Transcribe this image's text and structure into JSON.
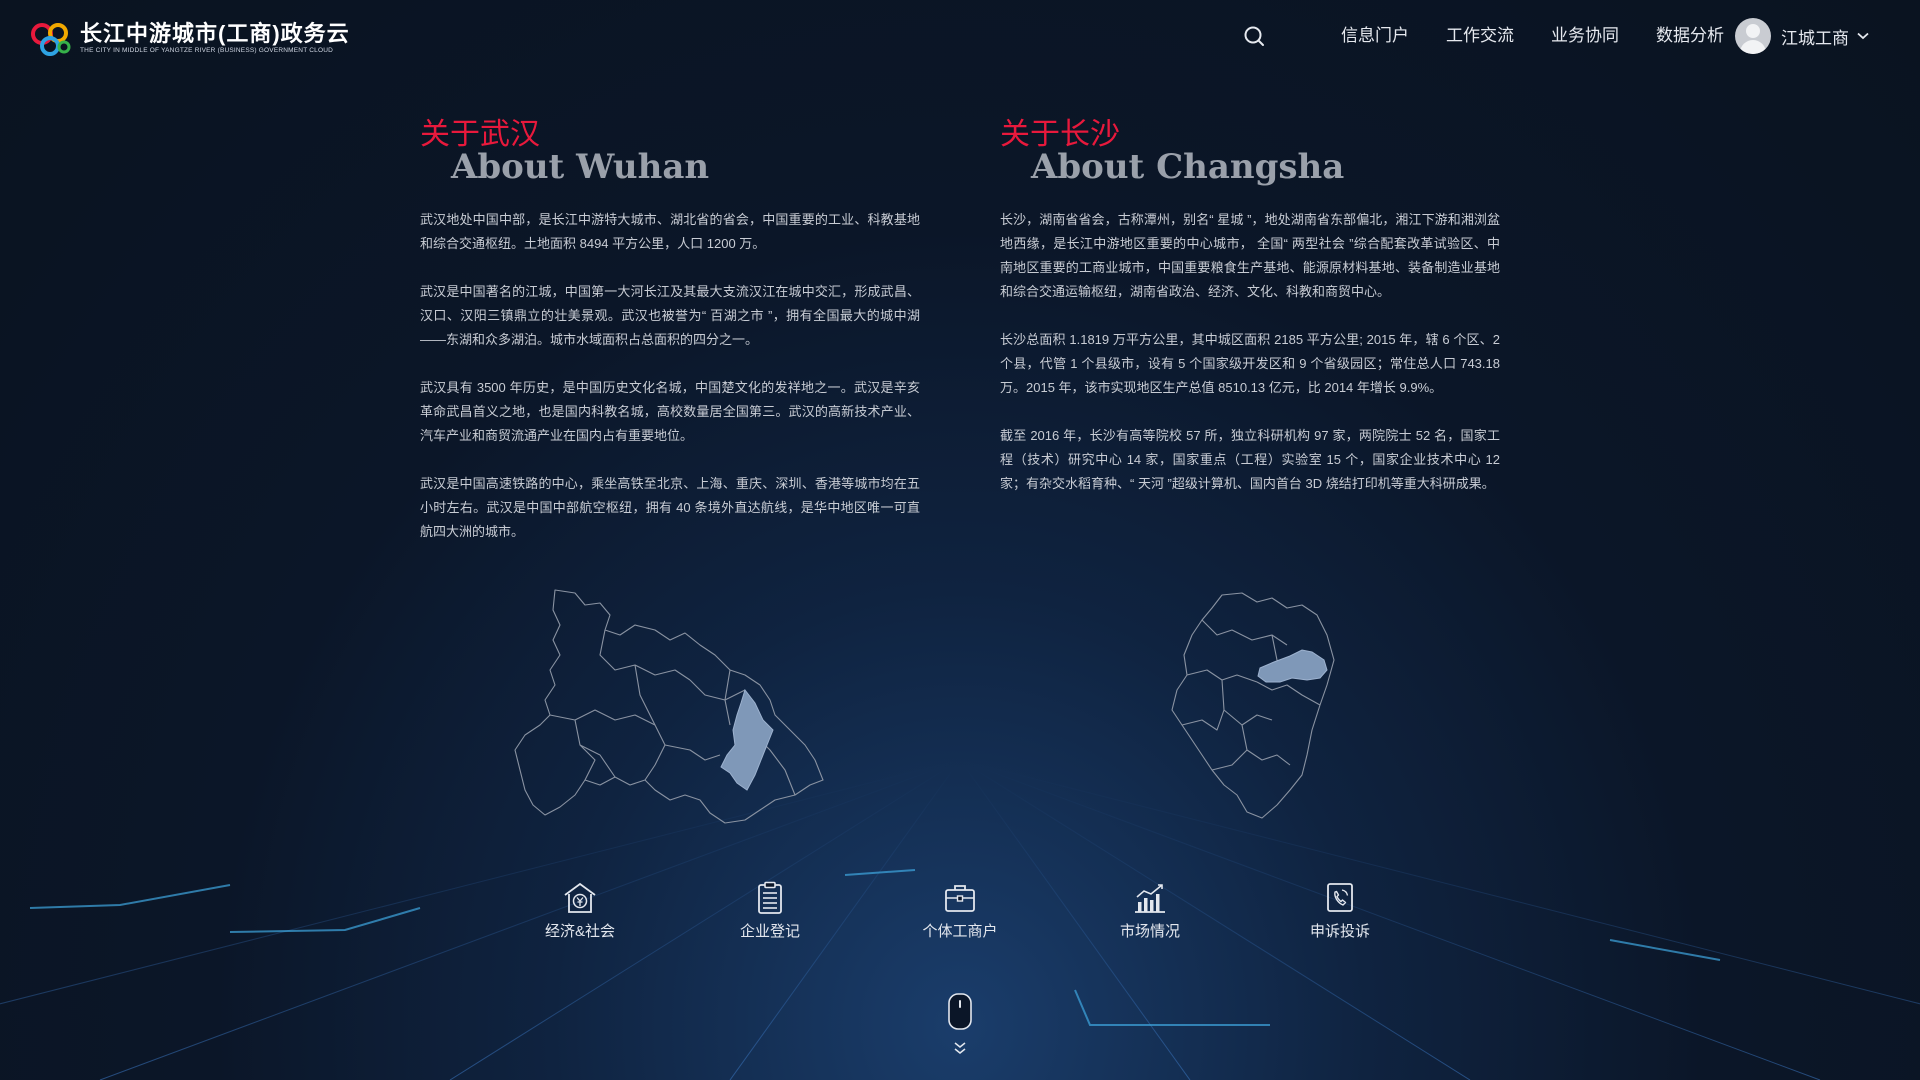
{
  "header": {
    "logo_title": "长江中游城市(工商)政务云",
    "logo_subtitle": "THE CITY IN MIDDLE OF YANGTZE RIVER (BUSINESS) GOVERNMENT CLOUD",
    "search_icon": "search-icon",
    "nav": [
      "信息门户",
      "工作交流",
      "业务协同",
      "数据分析"
    ],
    "user_name": "江城工商"
  },
  "wuhan": {
    "title_cn": "关于武汉",
    "title_en": "About Wuhan",
    "paragraphs": [
      "武汉地处中国中部，是长江中游特大城市、湖北省的省会，中国重要的工业、科教基地和综合交通枢纽。土地面积 8494 平方公里，人口 1200 万。",
      "武汉是中国著名的江城，中国第一大河长江及其最大支流汉江在城中交汇，形成武昌、汉口、汉阳三镇鼎立的壮美景观。武汉也被誉为“ 百湖之市 ”，拥有全国最大的城中湖——东湖和众多湖泊。城市水域面积占总面积的四分之一。",
      "武汉具有  3500  年历史，是中国历史文化名城，中国楚文化的发祥地之一。武汉是辛亥革命武昌首义之地，也是国内科教名城，高校数量居全国第三。武汉的高新技术产业、汽车产业和商贸流通产业在国内占有重要地位。",
      "武汉是中国高速铁路的中心，乘坐高铁至北京、上海、重庆、深圳、香港等城市均在五小时左右。武汉是中国中部航空枢纽，拥有 40 条境外直达航线，是华中地区唯一可直航四大洲的城市。"
    ]
  },
  "changsha": {
    "title_cn": "关于长沙",
    "title_en": "About Changsha",
    "paragraphs": [
      "长沙，湖南省省会，古称潭州，别名“ 星城 ”，地处湖南省东部偏北，湘江下游和湘浏盆地西缘，是长江中游地区重要的中心城市， 全国“ 两型社会 ”综合配套改革试验区、中南地区重要的工商业城市，中国重要粮食生产基地、能源原材料基地、装备制造业基地和综合交通运输枢纽，湖南省政治、经济、文化、科教和商贸中心。",
      "长沙总面积 1.1819 万平方公里，其中城区面积 2185 平方公里; 2015 年，辖 6 个区、2 个县，代管 1 个县级市，设有 5 个国家级开发区和 9 个省级园区；常住总人口 743.18 万。2015 年，该市实现地区生产总值 8510.13 亿元，比 2014 年增长 9.9%。",
      "截至 2016 年，长沙有高等院校 57 所，独立科研机构 97 家，两院院士 52 名，国家工程（技术）研究中心 14 家，国家重点（工程）实验室 15 个，国家企业技术中心 12 家；有杂交水稻育种、“ 天河 ”超级计算机、国内首台 3D 烧结打印机等重大科研成果。"
    ]
  },
  "categories": [
    {
      "label": "经济&社会",
      "icon": "bank-house-icon"
    },
    {
      "label": "企业登记",
      "icon": "clipboard-icon"
    },
    {
      "label": "个体工商户",
      "icon": "briefcase-icon"
    },
    {
      "label": "市场情况",
      "icon": "bar-chart-icon"
    },
    {
      "label": "申诉投诉",
      "icon": "phone-complaint-icon"
    }
  ],
  "colors": {
    "accent_red": "#e8193c",
    "map_highlight": "#7f98b8",
    "map_outline": "#8a93a2"
  }
}
